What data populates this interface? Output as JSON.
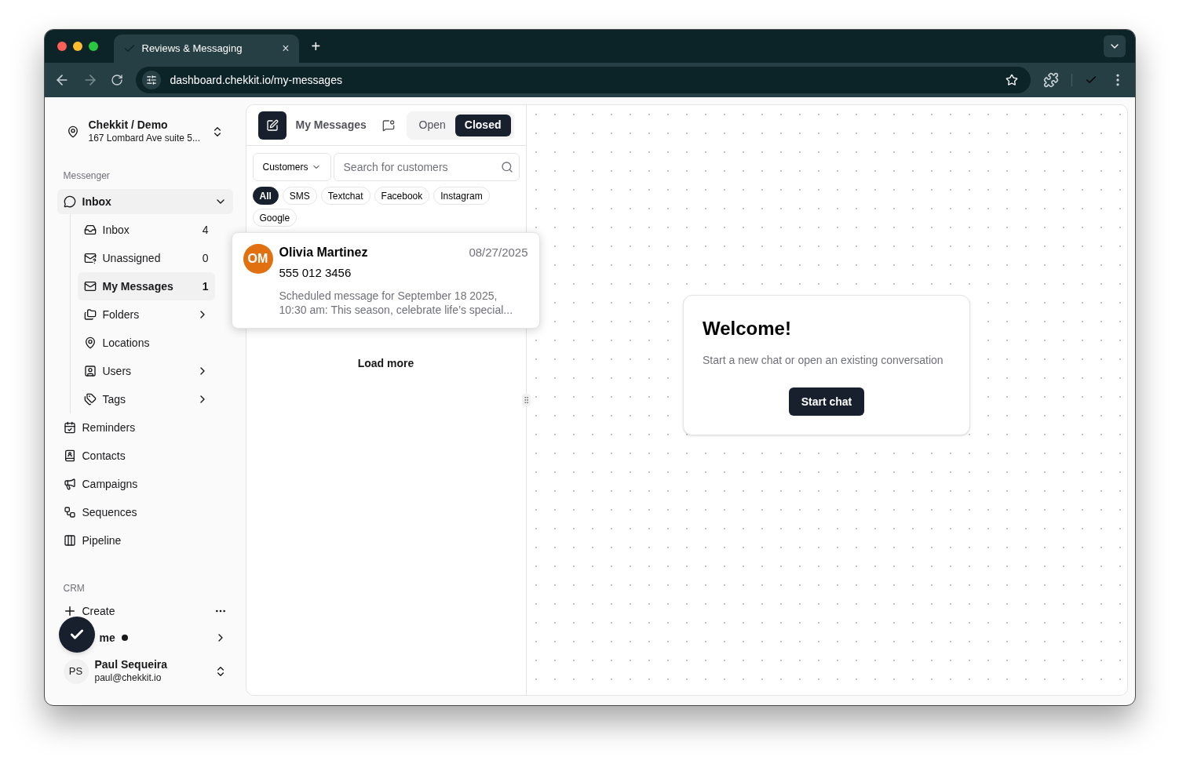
{
  "browser": {
    "tab_title": "Reviews & Messaging",
    "tab_close": "×",
    "new_tab": "+",
    "url": "dashboard.chekkit.io/my-messages"
  },
  "sidebar": {
    "org": {
      "name": "Chekkit / Demo",
      "address": "167 Lombard Ave suite 5..."
    },
    "section_label": "Messenger",
    "group": {
      "label": "Inbox",
      "expanded": true,
      "children": [
        {
          "label": "Inbox",
          "count": "4",
          "selected": false,
          "has_submenu": false
        },
        {
          "label": "Unassigned",
          "count": "0",
          "selected": false,
          "has_submenu": false
        },
        {
          "label": "My Messages",
          "count": "1",
          "selected": true,
          "has_submenu": false
        },
        {
          "label": "Folders",
          "selected": false,
          "has_submenu": true
        },
        {
          "label": "Locations",
          "selected": false,
          "has_submenu": false
        },
        {
          "label": "Users",
          "selected": false,
          "has_submenu": true
        },
        {
          "label": "Tags",
          "selected": false,
          "has_submenu": true
        }
      ]
    },
    "items": [
      {
        "label": "Reminders"
      },
      {
        "label": "Contacts"
      },
      {
        "label": "Campaigns"
      },
      {
        "label": "Sequences"
      },
      {
        "label": "Pipeline"
      }
    ],
    "crm_label": "CRM",
    "create": "Create",
    "home": {
      "label": "me",
      "unread": true
    },
    "user": {
      "initials": "PS",
      "name": "Paul Sequeira",
      "email": "paul@chekkit.io"
    }
  },
  "messages": {
    "title": "My Messages",
    "status_toggle": [
      {
        "label": "Open",
        "selected": false
      },
      {
        "label": "Closed",
        "selected": true
      }
    ],
    "filter_dropdown": "Customers",
    "search": {
      "placeholder": "Search for customers"
    },
    "channels": [
      {
        "label": "All",
        "selected": true
      },
      {
        "label": "SMS",
        "selected": false
      },
      {
        "label": "Textchat",
        "selected": false
      },
      {
        "label": "Facebook",
        "selected": false
      },
      {
        "label": "Instagram",
        "selected": false
      },
      {
        "label": "Google",
        "selected": false
      }
    ],
    "conversations": [
      {
        "initials": "OM",
        "color": "#e07010",
        "name": "Olivia Martinez",
        "date": "08/27/2025",
        "phone": "555 012 3456",
        "preview": "Scheduled message for September 18 2025, 10:30 am: This season, celebrate life’s special..."
      }
    ],
    "load_more": "Load more"
  },
  "welcome": {
    "title": "Welcome!",
    "subtitle": "Start a new chat or open an existing conversation",
    "button": "Start chat"
  }
}
